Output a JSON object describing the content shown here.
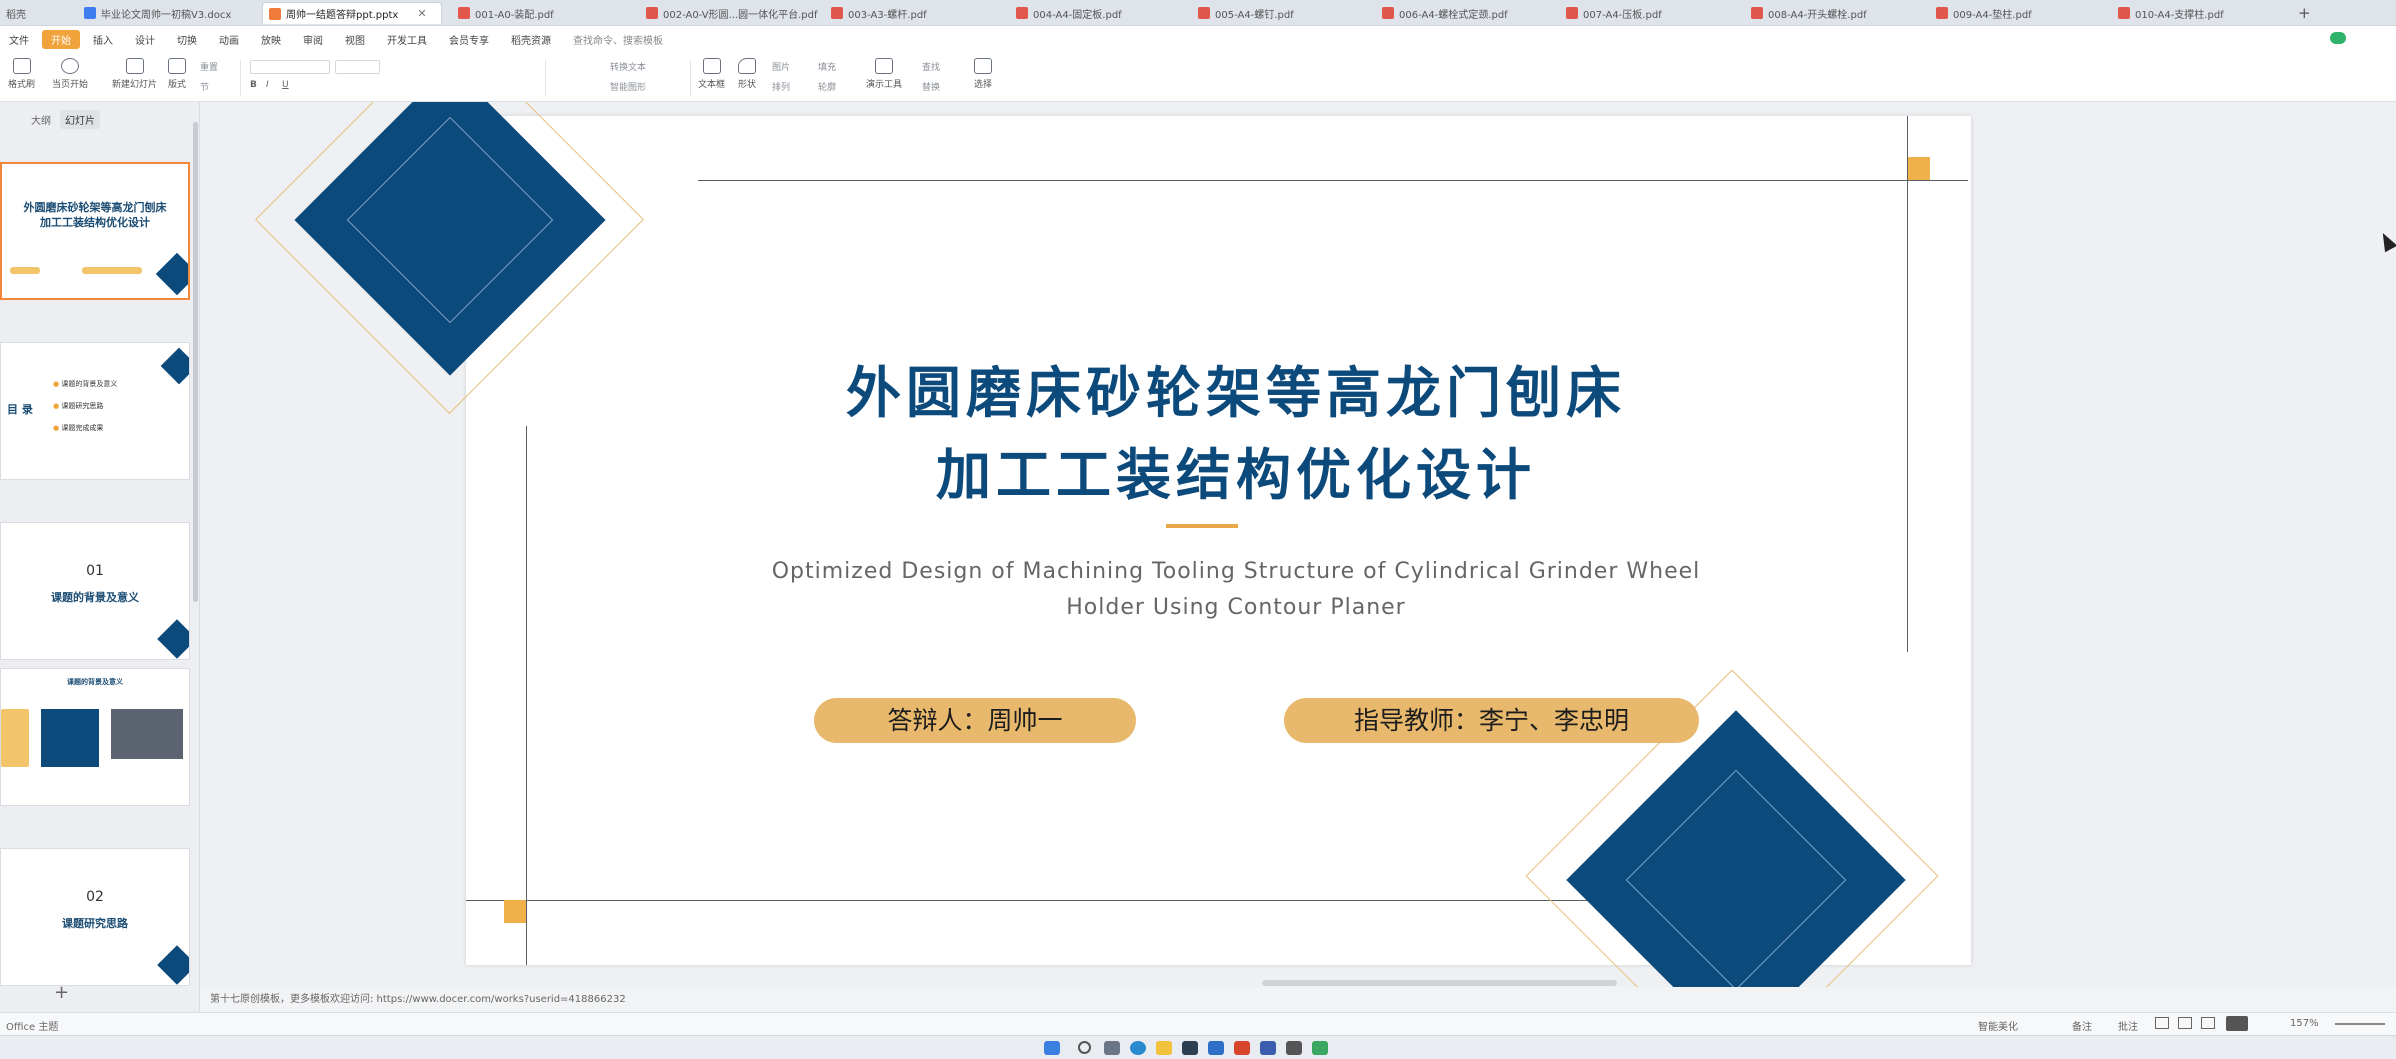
{
  "tabs": [
    {
      "label": "稻壳",
      "type": "none"
    },
    {
      "label": "毕业论文周帅一初稿V3.docx",
      "type": "doc"
    },
    {
      "label": "周帅一结题答辩ppt.pptx",
      "type": "ppt",
      "active": true
    },
    {
      "label": "001-A0-装配.pdf",
      "type": "pdf"
    },
    {
      "label": "002-A0-V形圆...圆一体化平台.pdf",
      "type": "pdf"
    },
    {
      "label": "003-A3-螺杆.pdf",
      "type": "pdf"
    },
    {
      "label": "004-A4-固定板.pdf",
      "type": "pdf"
    },
    {
      "label": "005-A4-螺钉.pdf",
      "type": "pdf"
    },
    {
      "label": "006-A4-螺栓式定颈.pdf",
      "type": "pdf"
    },
    {
      "label": "007-A4-压板.pdf",
      "type": "pdf"
    },
    {
      "label": "008-A4-开头螺栓.pdf",
      "type": "pdf"
    },
    {
      "label": "009-A4-垫柱.pdf",
      "type": "pdf"
    },
    {
      "label": "010-A4-支撑柱.pdf",
      "type": "pdf"
    }
  ],
  "new_tab": "+",
  "menu": [
    "文件",
    "开始",
    "插入",
    "设计",
    "切换",
    "动画",
    "放映",
    "审阅",
    "视图",
    "开发工具",
    "会员专享",
    "稻壳资源",
    "查找命令、搜索模板"
  ],
  "menu_active_index": 1,
  "ribbon": {
    "new_slide": "新建幻灯片",
    "layout": "版式",
    "section": "节",
    "textbox": "文本框",
    "shape": "形状",
    "arrange": "排列",
    "picture": "图片",
    "fill": "填充",
    "find": "查找",
    "replace": "替换",
    "select": "选择",
    "play": "当页开始",
    "format": "格式刷",
    "reset": "重置",
    "smart": "智能图形",
    "tools": "演示工具",
    "text_convert": "转换文本",
    "outline": "轮廓"
  },
  "left_panel": {
    "tab_outline": "大纲",
    "tab_slides": "幻灯片",
    "slides": [
      {
        "title": "外圆磨床砂轮架等高龙门刨床\n加工工装结构优化设计"
      },
      {
        "title": "目 录",
        "items": [
          "课题的背景及意义",
          "课题研究思路",
          "课题完成成果"
        ]
      },
      {
        "num": "01",
        "title": "课题的背景及意义"
      },
      {
        "title": "课题的背景及意义"
      },
      {
        "num": "02",
        "title": "课题研究思路"
      }
    ],
    "add": "+"
  },
  "slide": {
    "title_line1": "外圆磨床砂轮架等高龙门刨床",
    "title_line2": "加工工装结构优化设计",
    "subtitle_line1": "Optimized Design of Machining Tooling Structure of Cylindrical Grinder Wheel",
    "subtitle_line2": "Holder Using Contour Planer",
    "presenter": "答辩人：周帅一",
    "advisor": "指导教师：李宁、李忠明"
  },
  "note": "第十七原创模板，更多模板欢迎访问: https://www.docer.com/works?userid=418866232",
  "status": {
    "theme": "Office 主题",
    "smart_beautify": "智能美化",
    "notes": "备注",
    "comments": "批注",
    "zoom": "157%"
  },
  "colors": {
    "brand_blue": "#0d4a7c",
    "gold": "#e8b96c",
    "accent_orange": "#f0a23b"
  }
}
